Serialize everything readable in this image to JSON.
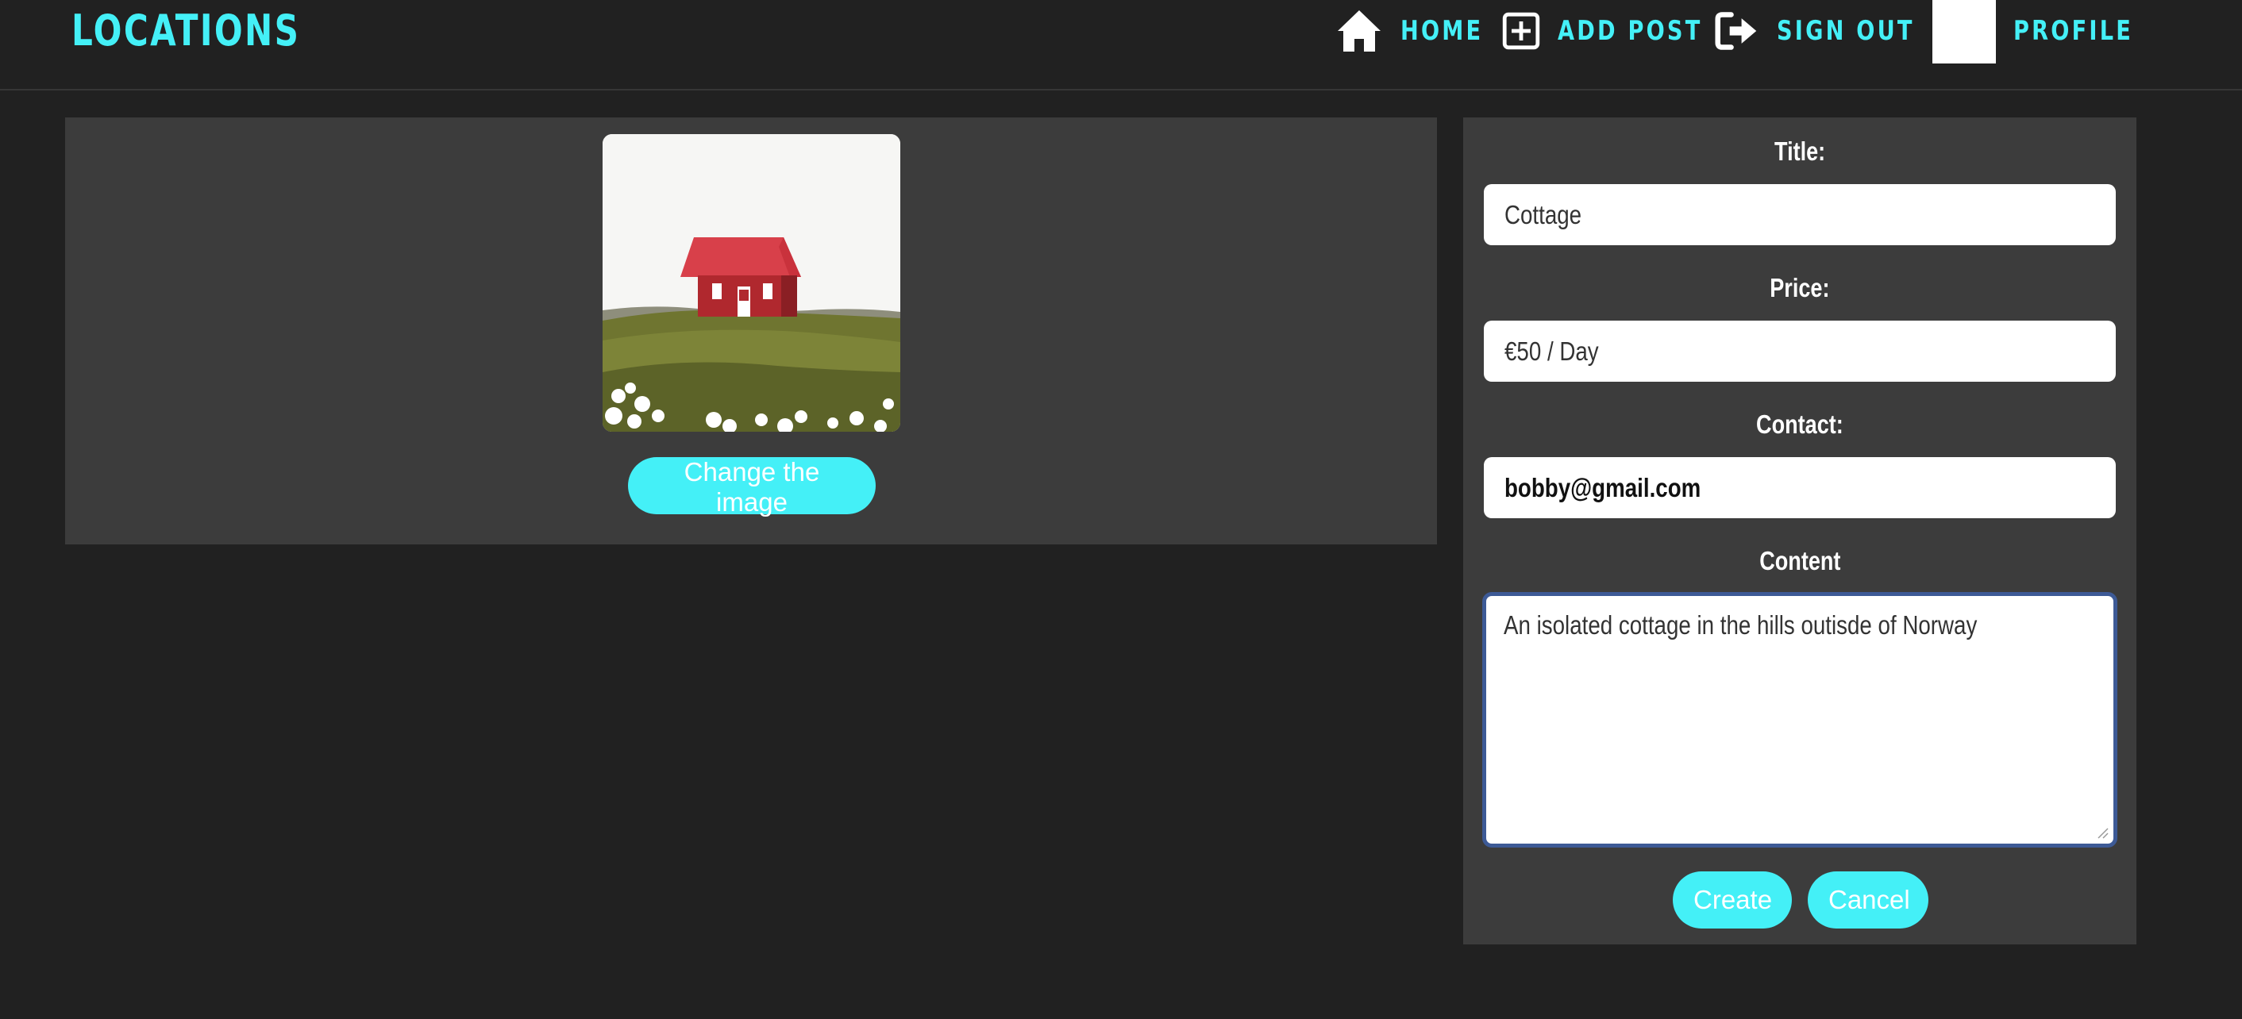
{
  "header": {
    "brand": "LOCATIONS",
    "nav": [
      {
        "label": "HOME",
        "icon": "home-icon"
      },
      {
        "label": "ADD POST",
        "icon": "plus-square-icon"
      },
      {
        "label": "SIGN OUT",
        "icon": "sign-out-icon"
      },
      {
        "label": "PROFILE",
        "icon": "avatar"
      }
    ]
  },
  "image_panel": {
    "image": "cottage-photo",
    "change_button": "Change the image"
  },
  "form": {
    "title_label": "Title:",
    "title_value": "Cottage",
    "price_label": "Price:",
    "price_value": "€50 / Day",
    "contact_label": "Contact:",
    "contact_value": "bobby@gmail.com",
    "content_label": "Content",
    "content_value": "An isolated cottage in the hills outisde of Norway",
    "create_button": "Create",
    "cancel_button": "Cancel"
  },
  "colors": {
    "accent": "#44f0f7",
    "background": "#212121",
    "panel": "#3c3c3c",
    "focus_border": "#3d5a96"
  }
}
